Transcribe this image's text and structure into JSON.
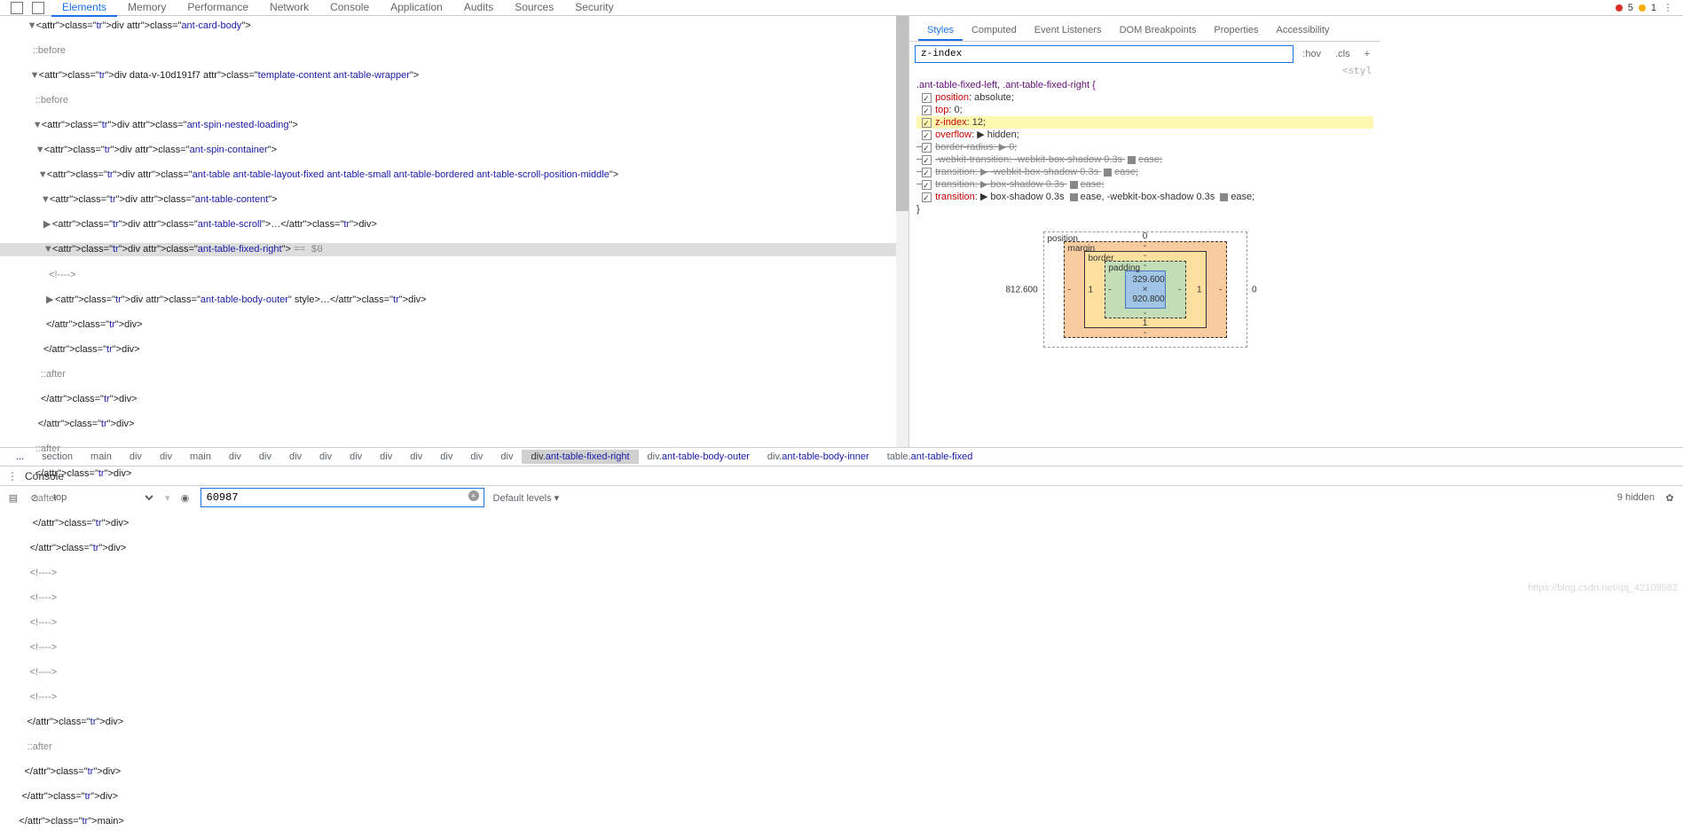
{
  "topbar": {
    "tabs": [
      "Elements",
      "Memory",
      "Performance",
      "Network",
      "Console",
      "Application",
      "Audits",
      "Sources",
      "Security"
    ],
    "activeTab": "Elements",
    "errors": "5",
    "warnings": "1"
  },
  "dom_lines": [
    {
      "i": 10,
      "a": "▼",
      "h": "<div class=\"ant-card-body\">"
    },
    {
      "i": 11,
      "a": "",
      "h": "::before",
      "psd": true
    },
    {
      "i": 11,
      "a": "▼",
      "h": "<div data-v-10d191f7 class=\"template-content ant-table-wrapper\">"
    },
    {
      "i": 12,
      "a": "",
      "h": "::before",
      "psd": true
    },
    {
      "i": 12,
      "a": "▼",
      "h": "<div class=\"ant-spin-nested-loading\">"
    },
    {
      "i": 13,
      "a": "▼",
      "h": "<div class=\"ant-spin-container\">"
    },
    {
      "i": 14,
      "a": "▼",
      "h": "<div class=\"ant-table ant-table-layout-fixed ant-table-small ant-table-bordered ant-table-scroll-position-middle\">"
    },
    {
      "i": 15,
      "a": "▼",
      "h": "<div class=\"ant-table-content\">"
    },
    {
      "i": 16,
      "a": "▶",
      "h": "<div class=\"ant-table-scroll\">…</div>"
    },
    {
      "i": 16,
      "a": "▼",
      "h": "<div class=\"ant-table-fixed-right\"> == $0",
      "sel": true
    },
    {
      "i": 17,
      "a": "",
      "h": "<!---->",
      "psd": true
    },
    {
      "i": 17,
      "a": "▶",
      "h": "<div class=\"ant-table-body-outer\" style>…</div>"
    },
    {
      "i": 16,
      "a": "",
      "h": "</div>"
    },
    {
      "i": 15,
      "a": "",
      "h": "</div>"
    },
    {
      "i": 14,
      "a": "",
      "h": "::after",
      "psd": true
    },
    {
      "i": 14,
      "a": "",
      "h": "</div>"
    },
    {
      "i": 13,
      "a": "",
      "h": "</div>"
    },
    {
      "i": 12,
      "a": "",
      "h": "::after",
      "psd": true
    },
    {
      "i": 12,
      "a": "",
      "h": "</div>"
    },
    {
      "i": 11,
      "a": "",
      "h": "::after",
      "psd": true
    },
    {
      "i": 11,
      "a": "",
      "h": "</div>"
    },
    {
      "i": 10,
      "a": "",
      "h": "</div>"
    },
    {
      "i": 10,
      "a": "",
      "h": "<!---->",
      "psd": true
    },
    {
      "i": 10,
      "a": "",
      "h": "<!---->",
      "psd": true
    },
    {
      "i": 10,
      "a": "",
      "h": "<!---->",
      "psd": true
    },
    {
      "i": 10,
      "a": "",
      "h": "<!---->",
      "psd": true
    },
    {
      "i": 10,
      "a": "",
      "h": "<!---->",
      "psd": true
    },
    {
      "i": 10,
      "a": "",
      "h": "<!---->",
      "psd": true
    },
    {
      "i": 9,
      "a": "",
      "h": "</div>"
    },
    {
      "i": 9,
      "a": "",
      "h": "::after",
      "psd": true
    },
    {
      "i": 8,
      "a": "",
      "h": "</div>"
    },
    {
      "i": 7,
      "a": "",
      "h": "</div>"
    },
    {
      "i": 6,
      "a": "",
      "h": "</main>",
      "cut": true
    }
  ],
  "styles": {
    "subtabs": [
      "Styles",
      "Computed",
      "Event Listeners",
      "DOM Breakpoints",
      "Properties",
      "Accessibility"
    ],
    "activeSub": "Styles",
    "filterValue": "z-index",
    "hov": ":hov",
    "cls": ".cls",
    "truncated": "<styl",
    "selector": ".ant-table-fixed-left, .ant-table-fixed-right {",
    "props": [
      {
        "n": "position",
        "v": "absolute;",
        "hl": false,
        "st": false
      },
      {
        "n": "top",
        "v": "0;",
        "hl": false,
        "st": false
      },
      {
        "n": "z-index",
        "v": "12;",
        "hl": true,
        "st": false
      },
      {
        "n": "overflow",
        "v": "▶ hidden;",
        "hl": false,
        "st": false
      },
      {
        "n": "border-radius",
        "v": "▶ 0;",
        "hl": false,
        "st": true
      },
      {
        "n": "-webkit-transition",
        "v": " -webkit-box-shadow 0.3s ",
        "ease": "ease;",
        "hl": false,
        "st": true
      },
      {
        "n": "transition",
        "v": "▶ -webkit-box-shadow 0.3s ",
        "ease": "ease;",
        "hl": false,
        "st": true
      },
      {
        "n": "transition",
        "v": "▶ box-shadow 0.3s ",
        "ease": "ease;",
        "hl": false,
        "st": true
      },
      {
        "n": "transition",
        "v": "▶ box-shadow 0.3s ",
        "ease": "ease, -webkit-box-shadow 0.3s ",
        "ease2": "ease;",
        "hl": false,
        "st": false
      }
    ],
    "close": "}"
  },
  "box": {
    "position_top": "0",
    "margin": {
      "t": "-",
      "r": "-",
      "b": "-",
      "l": "-"
    },
    "border": {
      "t": "-",
      "r": "1",
      "b": "1",
      "l": "1"
    },
    "padding": {
      "t": "-",
      "r": "-",
      "b": "-",
      "l": "-"
    },
    "content": "329.600 × 920.800",
    "outerLeft": "812.600",
    "outerRight": "0",
    "posLabel": "position",
    "marginLabel": "margin",
    "borderLabel": "border",
    "paddingLabel": "padding",
    "tail": "╎··· ╎"
  },
  "crumbs": [
    "...",
    "section",
    "main",
    "div",
    "div",
    "main",
    "div",
    "div",
    "div",
    "div",
    "div",
    "div",
    "div",
    "div",
    "div",
    "div",
    "div.ant-table-fixed-right",
    "div.ant-table-body-outer",
    "div.ant-table-body-inner",
    "table.ant-table-fixed"
  ],
  "crumb_selected": "div.ant-table-fixed-right",
  "console": {
    "title": "Console",
    "context": "top",
    "filter": "60987",
    "levels": "Default levels ▾",
    "hidden": "9 hidden"
  },
  "watermark": "https://blog.csdn.net/qq_42109582"
}
